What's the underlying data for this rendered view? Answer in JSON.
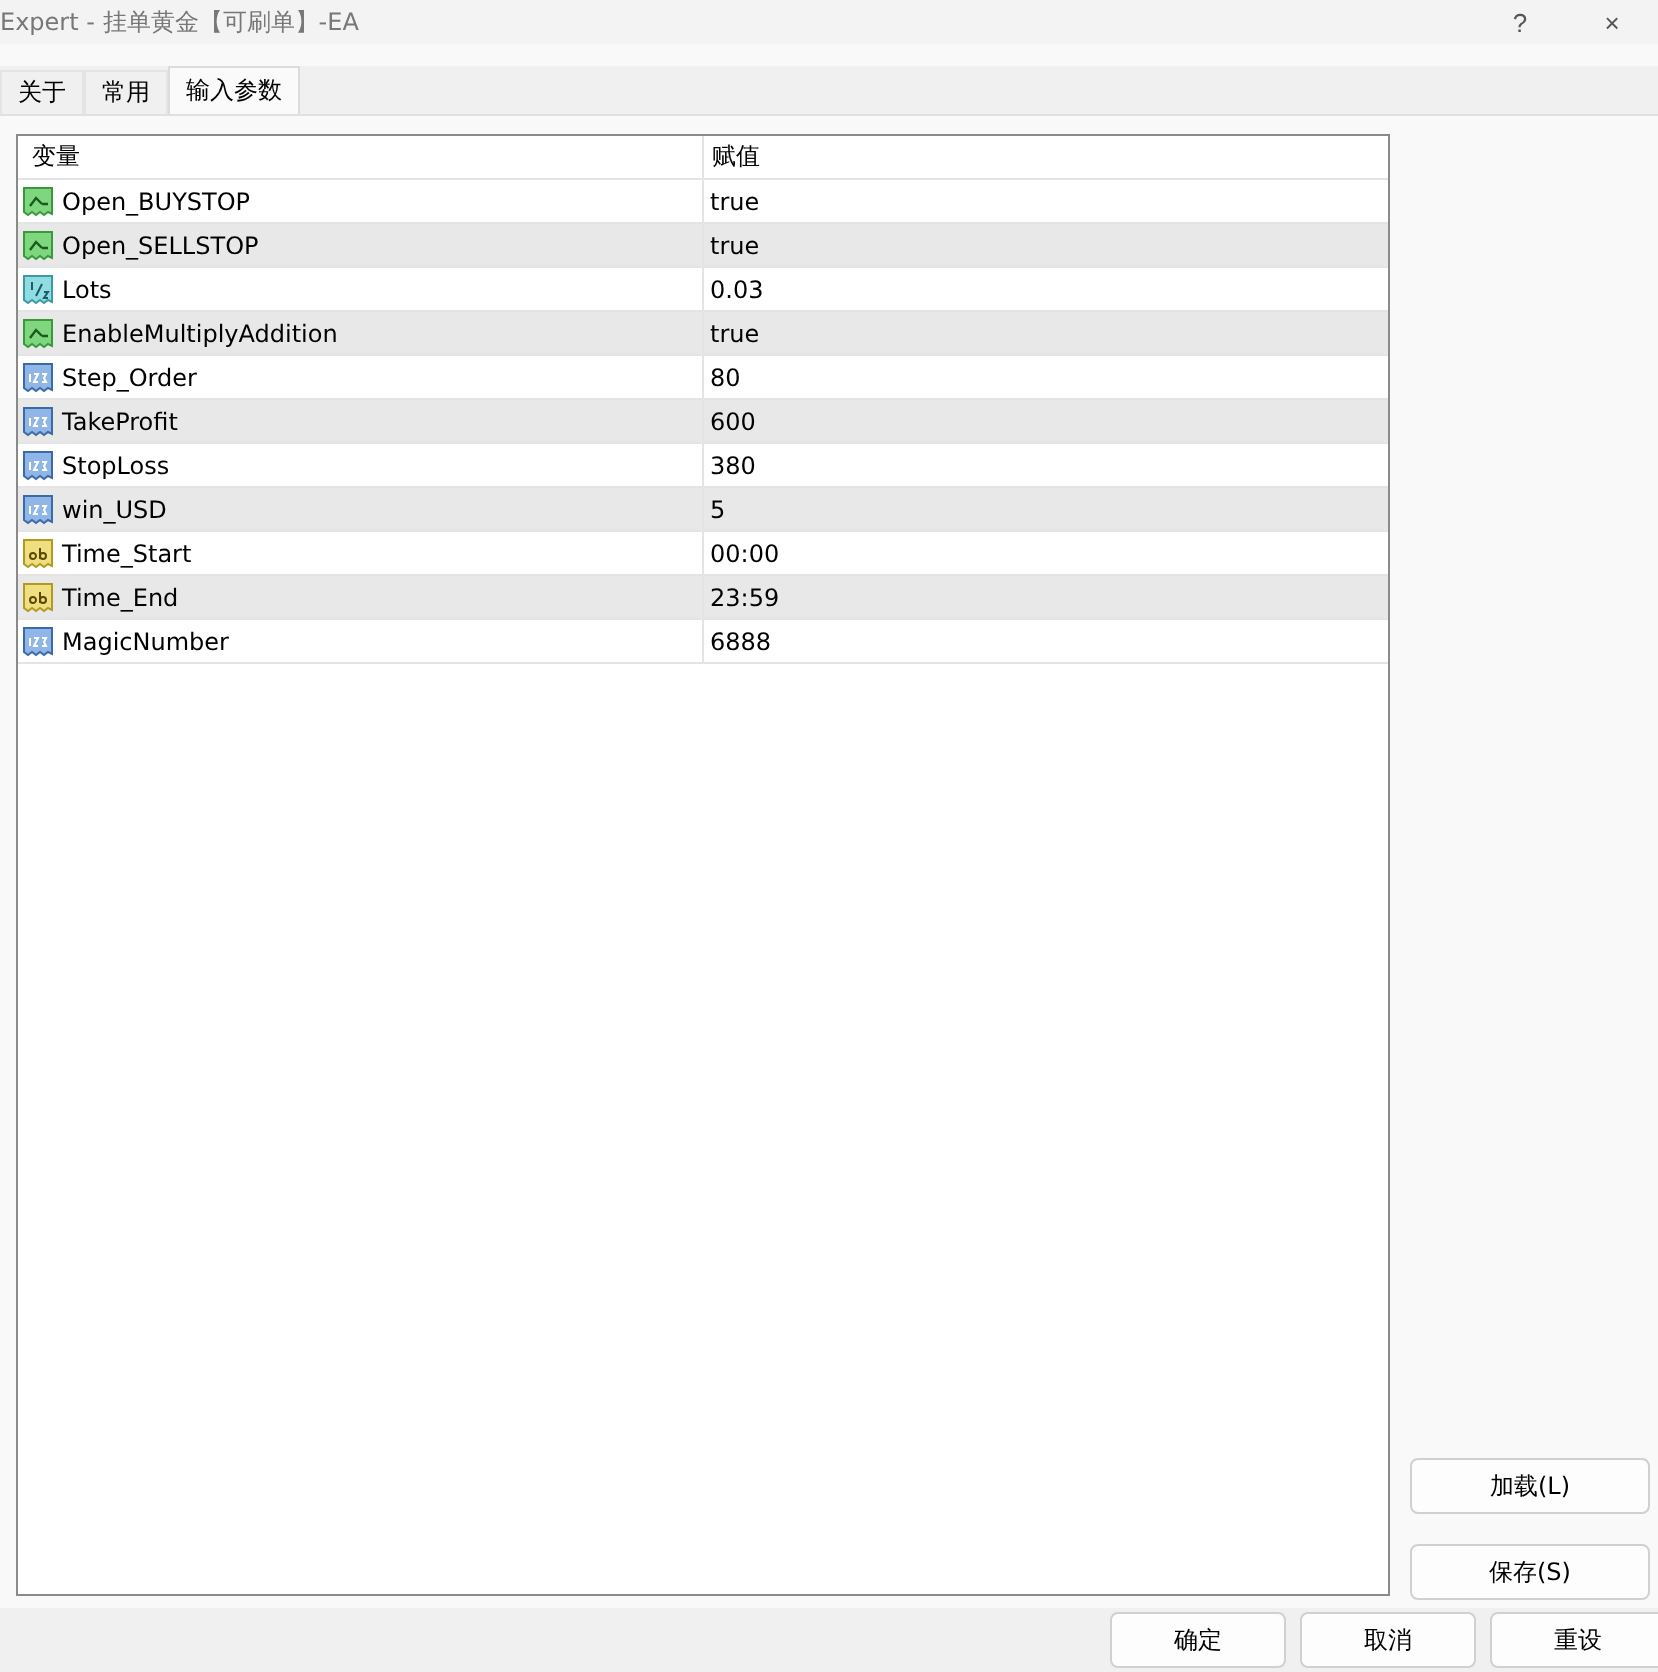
{
  "window": {
    "title": "Expert - 挂单黄金【可刷单】-EA",
    "help": "?",
    "close": "×"
  },
  "tabs": [
    {
      "label": "关于",
      "selected": false
    },
    {
      "label": "常用",
      "selected": false
    },
    {
      "label": "输入参数",
      "selected": true
    }
  ],
  "table": {
    "columns": [
      "变量",
      "赋值"
    ],
    "rows": [
      {
        "kind": "bool",
        "name": "Open_BUYSTOP",
        "value": "true"
      },
      {
        "kind": "bool",
        "name": "Open_SELLSTOP",
        "value": "true"
      },
      {
        "kind": "double",
        "name": "Lots",
        "value": "0.03"
      },
      {
        "kind": "bool",
        "name": "EnableMultiplyAddition",
        "value": "true"
      },
      {
        "kind": "int",
        "name": "Step_Order",
        "value": "80"
      },
      {
        "kind": "int",
        "name": "TakeProfit",
        "value": "600"
      },
      {
        "kind": "int",
        "name": "StopLoss",
        "value": "380"
      },
      {
        "kind": "int",
        "name": "win_USD",
        "value": "5"
      },
      {
        "kind": "string",
        "name": "Time_Start",
        "value": "00:00"
      },
      {
        "kind": "string",
        "name": "Time_End",
        "value": "23:59"
      },
      {
        "kind": "int",
        "name": "MagicNumber",
        "value": "6888"
      }
    ]
  },
  "side_buttons": [
    "加载(L)",
    "保存(S)"
  ],
  "footer_buttons": [
    "确定",
    "取消",
    "重设"
  ]
}
